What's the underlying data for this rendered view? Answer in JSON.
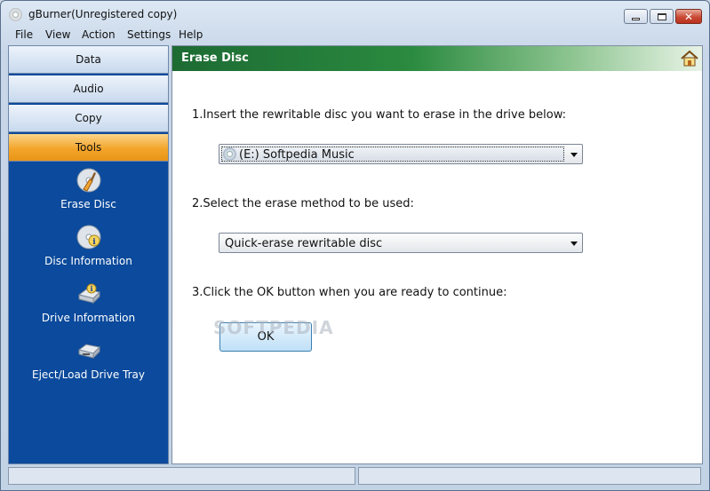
{
  "window": {
    "title": "gBurner(Unregistered copy)"
  },
  "menu": [
    {
      "label": "File"
    },
    {
      "label": "View"
    },
    {
      "label": "Action"
    },
    {
      "label": "Settings"
    },
    {
      "label": "Help"
    }
  ],
  "sidebar": {
    "tabs": [
      {
        "label": "Data"
      },
      {
        "label": "Audio"
      },
      {
        "label": "Copy"
      },
      {
        "label": "Tools",
        "active": true
      }
    ],
    "tools": [
      {
        "label": "Erase Disc",
        "icon": "erase-disc-icon"
      },
      {
        "label": "Disc Information",
        "icon": "disc-information-icon"
      },
      {
        "label": "Drive Information",
        "icon": "drive-information-icon"
      },
      {
        "label": "Eject/Load Drive Tray",
        "icon": "eject-load-icon"
      }
    ]
  },
  "panel": {
    "title": "Erase Disc",
    "step1": "1.Insert the rewritable disc you want to erase in the drive below:",
    "drive_value": "(E:) Softpedia Music",
    "step2": "2.Select the erase method to be used:",
    "method_value": "Quick-erase rewritable disc",
    "step3": "3.Click the OK button when you are ready to continue:",
    "ok_label": "OK",
    "watermark": "SOFTPEDIA"
  },
  "colors": {
    "sidebar_bg": "#0b4a9c",
    "active_tab": "#f3a52a",
    "header_green": "#1d6b33"
  }
}
